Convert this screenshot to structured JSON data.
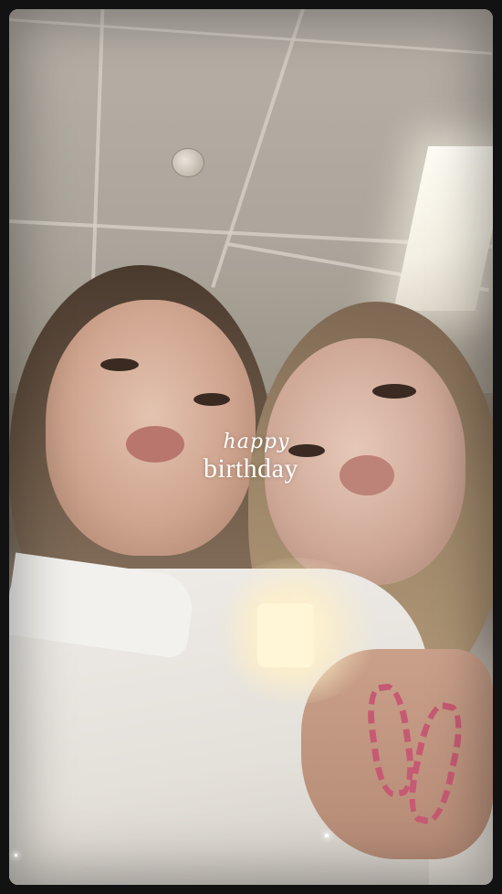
{
  "story": {
    "caption_script": "happy",
    "caption_main": "birthday"
  },
  "colors": {
    "frame": "#121212",
    "caption_text": "#ffffff",
    "bracelet": "#c65a72",
    "shirt": "#e8e4de"
  }
}
